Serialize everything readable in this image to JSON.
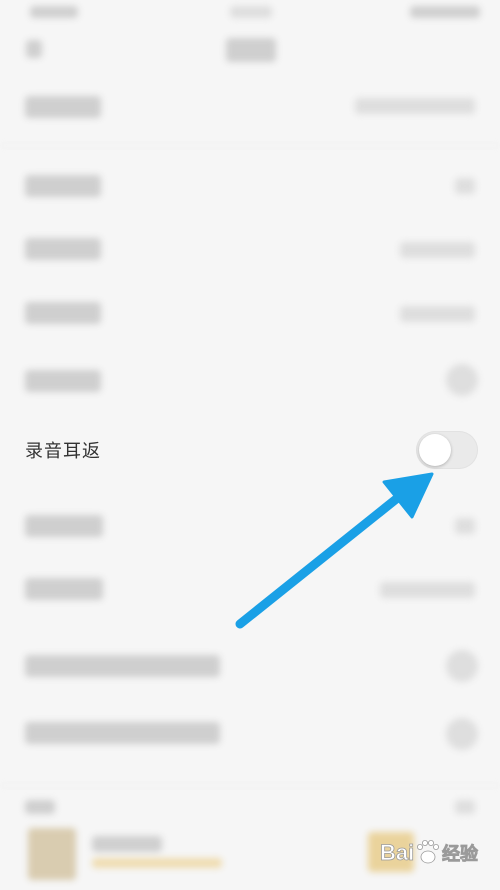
{
  "settings": {
    "ear_return": {
      "label": "录音耳返",
      "enabled": false
    }
  },
  "annotation": {
    "arrow_color": "#1aa0e6"
  },
  "watermark": {
    "brand": "Bai",
    "suffix": "经验",
    "icon": "paw-icon"
  }
}
